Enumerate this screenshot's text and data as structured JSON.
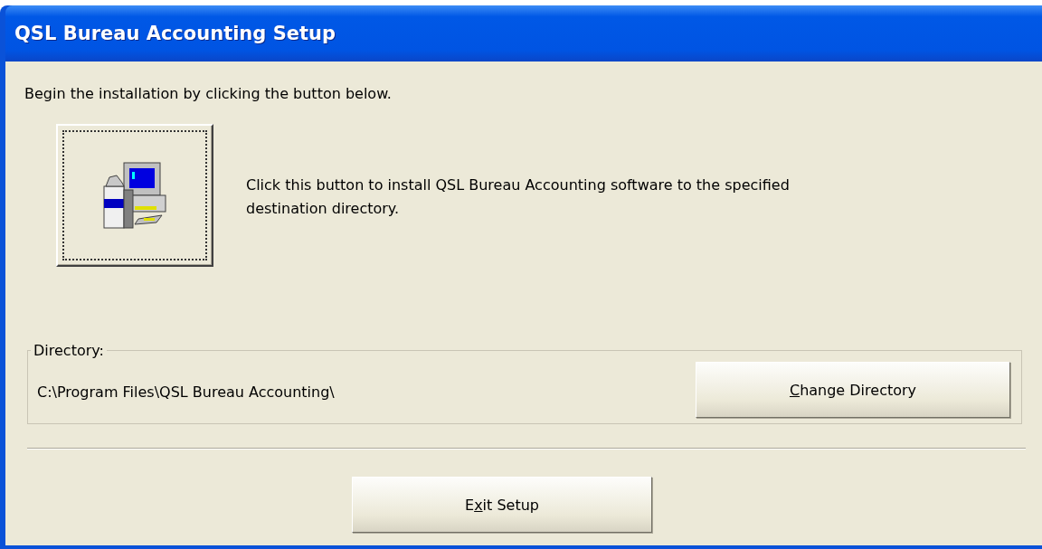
{
  "window": {
    "title": "QSL Bureau Accounting Setup"
  },
  "intro": "Begin the installation by clicking the button below.",
  "install": {
    "focused": true,
    "description": "Click this button to install QSL Bureau Accounting software to the specified destination directory."
  },
  "directory": {
    "legend": "Directory:",
    "path": "C:\\Program Files\\QSL Bureau Accounting\\",
    "button": {
      "key": "C",
      "post": "hange Directory"
    }
  },
  "exit_button": {
    "pre": "E",
    "key": "x",
    "post": "it Setup"
  }
}
